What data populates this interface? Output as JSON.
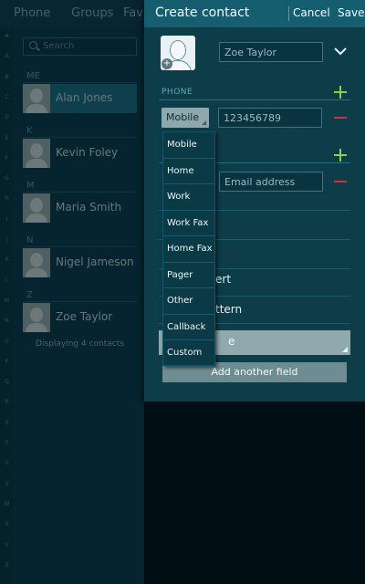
{
  "background": {
    "tabs": [
      "Phone",
      "Groups",
      "Favo"
    ],
    "index_letters": [
      "#",
      "A",
      "B",
      "C",
      "D",
      "E",
      "F",
      "G",
      "H",
      "I",
      "J",
      "K",
      "L",
      "M",
      "N",
      "O",
      "P",
      "Q",
      "R",
      "S",
      "T",
      "U",
      "V",
      "W",
      "X",
      "Y",
      "Z"
    ],
    "search_placeholder": "Search",
    "sections": [
      {
        "header": "ME",
        "contact": "Alan Jones",
        "selected": true
      },
      {
        "header": "K",
        "contact": "Kevin Foley",
        "selected": false
      },
      {
        "header": "M",
        "contact": "Maria Smith",
        "selected": false
      },
      {
        "header": "N",
        "contact": "Nigel Jameson",
        "selected": false
      },
      {
        "header": "Z",
        "contact": "Zoe Taylor",
        "selected": false
      }
    ],
    "footer": "Displaying 4 contacts"
  },
  "panel": {
    "title": "Create contact",
    "cancel_label": "Cancel",
    "save_label": "Save",
    "name_placeholder": "Zoe Taylor",
    "phone_section": "PHONE",
    "phone_type": "Mobile",
    "phone_placeholder": "123456789",
    "email_placeholder": "Email address",
    "partial_rows": [
      "ert",
      "ttern"
    ],
    "group_partial": "e",
    "add_field_label": "Add another field"
  },
  "dropdown": {
    "options": [
      "Mobile",
      "Home",
      "Work",
      "Work Fax",
      "Home Fax",
      "Pager",
      "Other",
      "Callback",
      "Custom"
    ]
  },
  "colors": {
    "accent_green": "#8ed13f",
    "remove_red": "#d52f2f",
    "header_bg": "#155e6f"
  },
  "icons": {
    "add": "plus-icon",
    "remove": "minus-icon",
    "expand": "chevron-down-icon",
    "photo_add": "add-photo-icon"
  }
}
